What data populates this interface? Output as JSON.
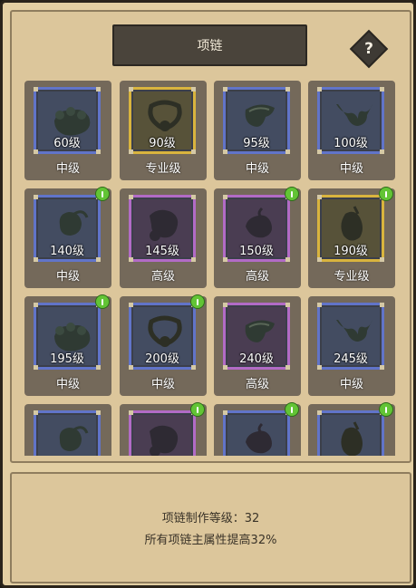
{
  "header": {
    "title": "项链",
    "help_label": "?"
  },
  "items": [
    {
      "level": "60级",
      "tier": "中级",
      "quality": "blue",
      "badge": false
    },
    {
      "level": "90级",
      "tier": "专业级",
      "quality": "gold",
      "badge": false
    },
    {
      "level": "95级",
      "tier": "中级",
      "quality": "blue",
      "badge": false
    },
    {
      "level": "100级",
      "tier": "中级",
      "quality": "blue",
      "badge": false
    },
    {
      "level": "140级",
      "tier": "中级",
      "quality": "blue",
      "badge": true
    },
    {
      "level": "145级",
      "tier": "高级",
      "quality": "purple",
      "badge": false
    },
    {
      "level": "150级",
      "tier": "高级",
      "quality": "purple",
      "badge": true
    },
    {
      "level": "190级",
      "tier": "专业级",
      "quality": "gold",
      "badge": true
    },
    {
      "level": "195级",
      "tier": "中级",
      "quality": "blue",
      "badge": true
    },
    {
      "level": "200级",
      "tier": "中级",
      "quality": "blue",
      "badge": true
    },
    {
      "level": "240级",
      "tier": "高级",
      "quality": "purple",
      "badge": false
    },
    {
      "level": "245级",
      "tier": "中级",
      "quality": "blue",
      "badge": false
    },
    {
      "level": "",
      "tier": "",
      "quality": "blue",
      "badge": false
    },
    {
      "level": "",
      "tier": "",
      "quality": "purple",
      "badge": true
    },
    {
      "level": "",
      "tier": "",
      "quality": "blue",
      "badge": true
    },
    {
      "level": "",
      "tier": "",
      "quality": "blue",
      "badge": true
    }
  ],
  "footer": {
    "craft_level": "项链制作等级：32",
    "bonus": "所有项链主属性提高32%"
  }
}
